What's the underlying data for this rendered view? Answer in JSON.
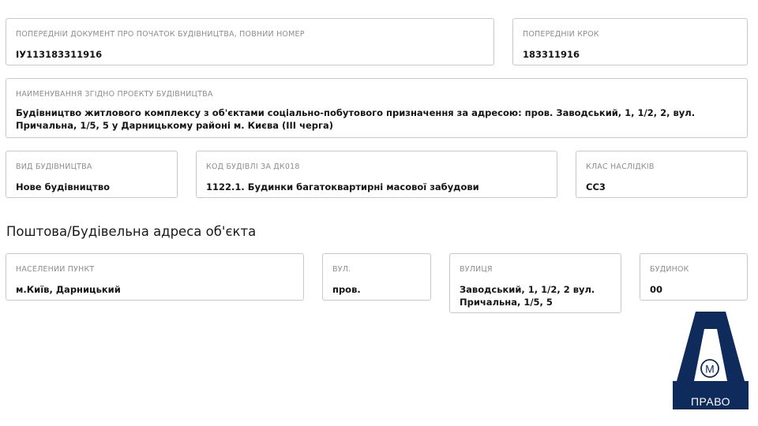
{
  "prev_document": {
    "label": "ПОПЕРЕДНІЙ ДОКУМЕНТ ПРО ПОЧАТОК БУДІВНИЦТВА, ПОВНИЙ НОМЕР",
    "value": "ІУ113183311916"
  },
  "prev_step": {
    "label": "ПОПЕРЕДНІЙ КРОК",
    "value": "183311916"
  },
  "project_name": {
    "label": "НАЙМЕНУВАННЯ ЗГІДНО ПРОЕКТУ БУДІВНИЦТВА",
    "value": "Будівництво житлового комплексу з об'єктами соціально-побутового призначення за адресою: пров. Заводський, 1, 1/2, 2, вул. Причальна, 1/5, 5 у Дарницькому районі м. Києва (ІІІ черга)"
  },
  "construction_type": {
    "label": "ВИД БУДІВНИЦТВА",
    "value": "Нове будівництво"
  },
  "building_code": {
    "label": "КОД БУДІВЛІ ЗА ДК018",
    "value": "1122.1. Будинки багатоквартирні масової забудови"
  },
  "consequence_class": {
    "label": "КЛАС НАСЛІДКІВ",
    "value": "СС3"
  },
  "address_section": {
    "title": "Поштова/Будівельна адреса об'єкта"
  },
  "locality": {
    "label": "НАСЕЛЕНИЙ ПУНКТ",
    "value": "м.Київ, Дарницький"
  },
  "street_type": {
    "label": "ВУЛ.",
    "value": "пров."
  },
  "street": {
    "label": "ВУЛИЦЯ",
    "value": "Заводський, 1, 1/2, 2 вул. Причальна, 1/5, 5"
  },
  "house": {
    "label": "БУДИНОК",
    "value": "00"
  },
  "logo": {
    "letter": "А",
    "badge": "М",
    "text": "ПРАВО",
    "color": "#0f2b5b"
  }
}
